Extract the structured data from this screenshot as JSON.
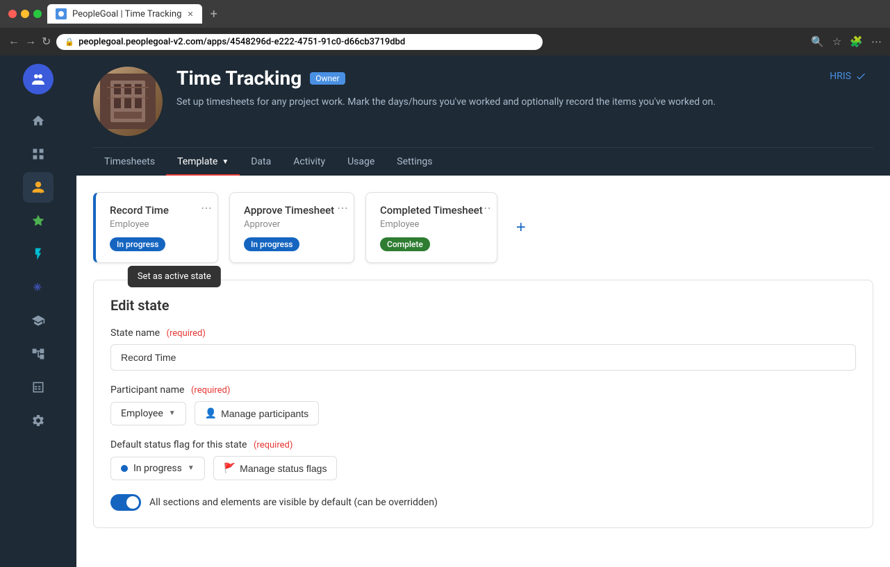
{
  "browser": {
    "tab_title": "PeopleGoal | Time Tracking",
    "url_prefix": "peoplegoal.peoplegoal-v2.com",
    "url_path": "/apps/4548296d-e222-4751-91c0-d66cb3719dbd",
    "new_tab_label": "+"
  },
  "app": {
    "title": "Time Tracking",
    "owner_badge": "Owner",
    "description": "Set up timesheets for any project work. Mark the days/hours you've worked and optionally record the items you've worked on.",
    "hris_label": "HRIS"
  },
  "nav": {
    "tabs": [
      {
        "id": "timesheets",
        "label": "Timesheets",
        "active": false
      },
      {
        "id": "template",
        "label": "Template",
        "active": true,
        "has_chevron": true
      },
      {
        "id": "data",
        "label": "Data",
        "active": false
      },
      {
        "id": "activity",
        "label": "Activity",
        "active": false
      },
      {
        "id": "usage",
        "label": "Usage",
        "active": false
      },
      {
        "id": "settings",
        "label": "Settings",
        "active": false
      }
    ]
  },
  "workflow": {
    "states": [
      {
        "id": "record-time",
        "title": "Record Time",
        "role": "Employee",
        "badge": "In progress",
        "badge_type": "inprogress",
        "active_card": true
      },
      {
        "id": "approve-timesheet",
        "title": "Approve Timesheet",
        "role": "Approver",
        "badge": "In progress",
        "badge_type": "inprogress",
        "active_card": false
      },
      {
        "id": "completed-timesheet",
        "title": "Completed Timesheet",
        "role": "Employee",
        "badge": "Complete",
        "badge_type": "complete",
        "active_card": false
      }
    ],
    "add_btn_label": "+",
    "tooltip_label": "Set as active state"
  },
  "edit_state": {
    "section_title": "Edit state",
    "state_name_label": "State name",
    "state_name_required": "(required)",
    "state_name_value": "Record Time",
    "participant_label": "Participant name",
    "participant_required": "(required)",
    "participant_value": "Employee",
    "manage_participants_label": "Manage participants",
    "manage_participants_icon": "👤",
    "default_status_label": "Default status flag for this state",
    "default_status_required": "(required)",
    "status_value": "In progress",
    "manage_status_label": "Manage status flags",
    "manage_status_icon": "🚩",
    "visibility_label": "All sections and elements are visible by default (can be overridden)"
  },
  "sidebar": {
    "avatar_icon": "👥",
    "nav_items": [
      {
        "id": "home",
        "icon": "⌂",
        "active": false
      },
      {
        "id": "grid",
        "icon": "▦",
        "active": false
      },
      {
        "id": "person-edit",
        "icon": "✏",
        "active": true
      },
      {
        "id": "star",
        "icon": "★",
        "active": false
      },
      {
        "id": "bolt",
        "icon": "⚡",
        "active": false
      },
      {
        "id": "asterisk",
        "icon": "✳",
        "active": false
      },
      {
        "id": "graduation",
        "icon": "🎓",
        "active": false
      },
      {
        "id": "hierarchy",
        "icon": "⋮",
        "active": false
      },
      {
        "id": "table",
        "icon": "▦",
        "active": false
      },
      {
        "id": "settings",
        "icon": "⚙",
        "active": false
      }
    ]
  }
}
